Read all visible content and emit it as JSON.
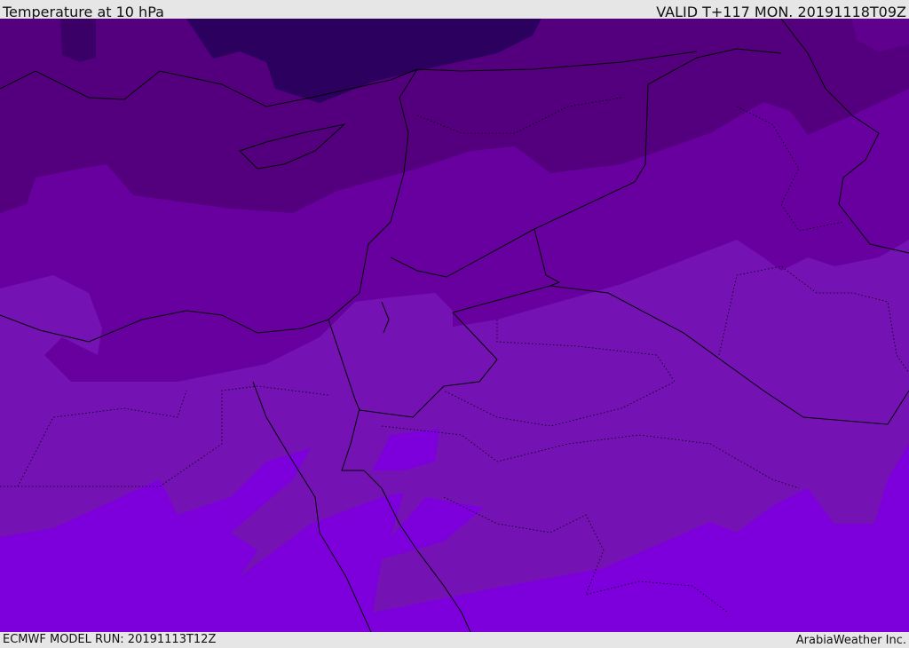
{
  "header": {
    "title": "Temperature at 10 hPa",
    "valid": "VALID T+117 MON. 20191118T09Z"
  },
  "footer": {
    "model_run": "ECMWF MODEL RUN: 20191113T12Z",
    "credit": "ArabiaWeather Inc."
  },
  "colors": {
    "band_darkest": "#2c005e",
    "band_dark": "#3a0068",
    "band_upper": "#54007e",
    "band_mid": "#6800a0",
    "band_low": "#7412b4",
    "band_lightest": "#7d00dc"
  }
}
